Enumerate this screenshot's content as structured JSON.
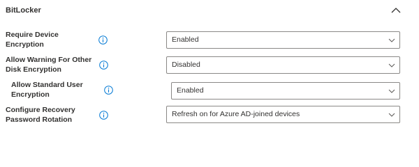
{
  "section": {
    "title": "BitLocker",
    "collapse_icon": "chevron-up-icon"
  },
  "settings": [
    {
      "label": "Require Device Encryption",
      "label_lines": [
        "Require Device",
        "Encryption"
      ],
      "value": "Enabled"
    },
    {
      "label": "Allow Warning For Other Disk Encryption",
      "label_lines": [
        "Allow Warning For Other",
        "Disk Encryption"
      ],
      "value": "Disabled"
    },
    {
      "label": "Allow Standard User Encryption",
      "label_lines": [
        "Allow Standard User",
        "Encryption"
      ],
      "value": "Enabled"
    },
    {
      "label": "Configure Recovery Password Rotation",
      "label_lines": [
        "Configure Recovery",
        "Password Rotation"
      ],
      "value": "Refresh on for Azure AD-joined devices"
    }
  ],
  "icons": {
    "info": "info-icon",
    "dropdown": "chevron-down-icon"
  },
  "colors": {
    "info_icon": "#0078d4",
    "border": "#8a8886",
    "text": "#323130"
  }
}
